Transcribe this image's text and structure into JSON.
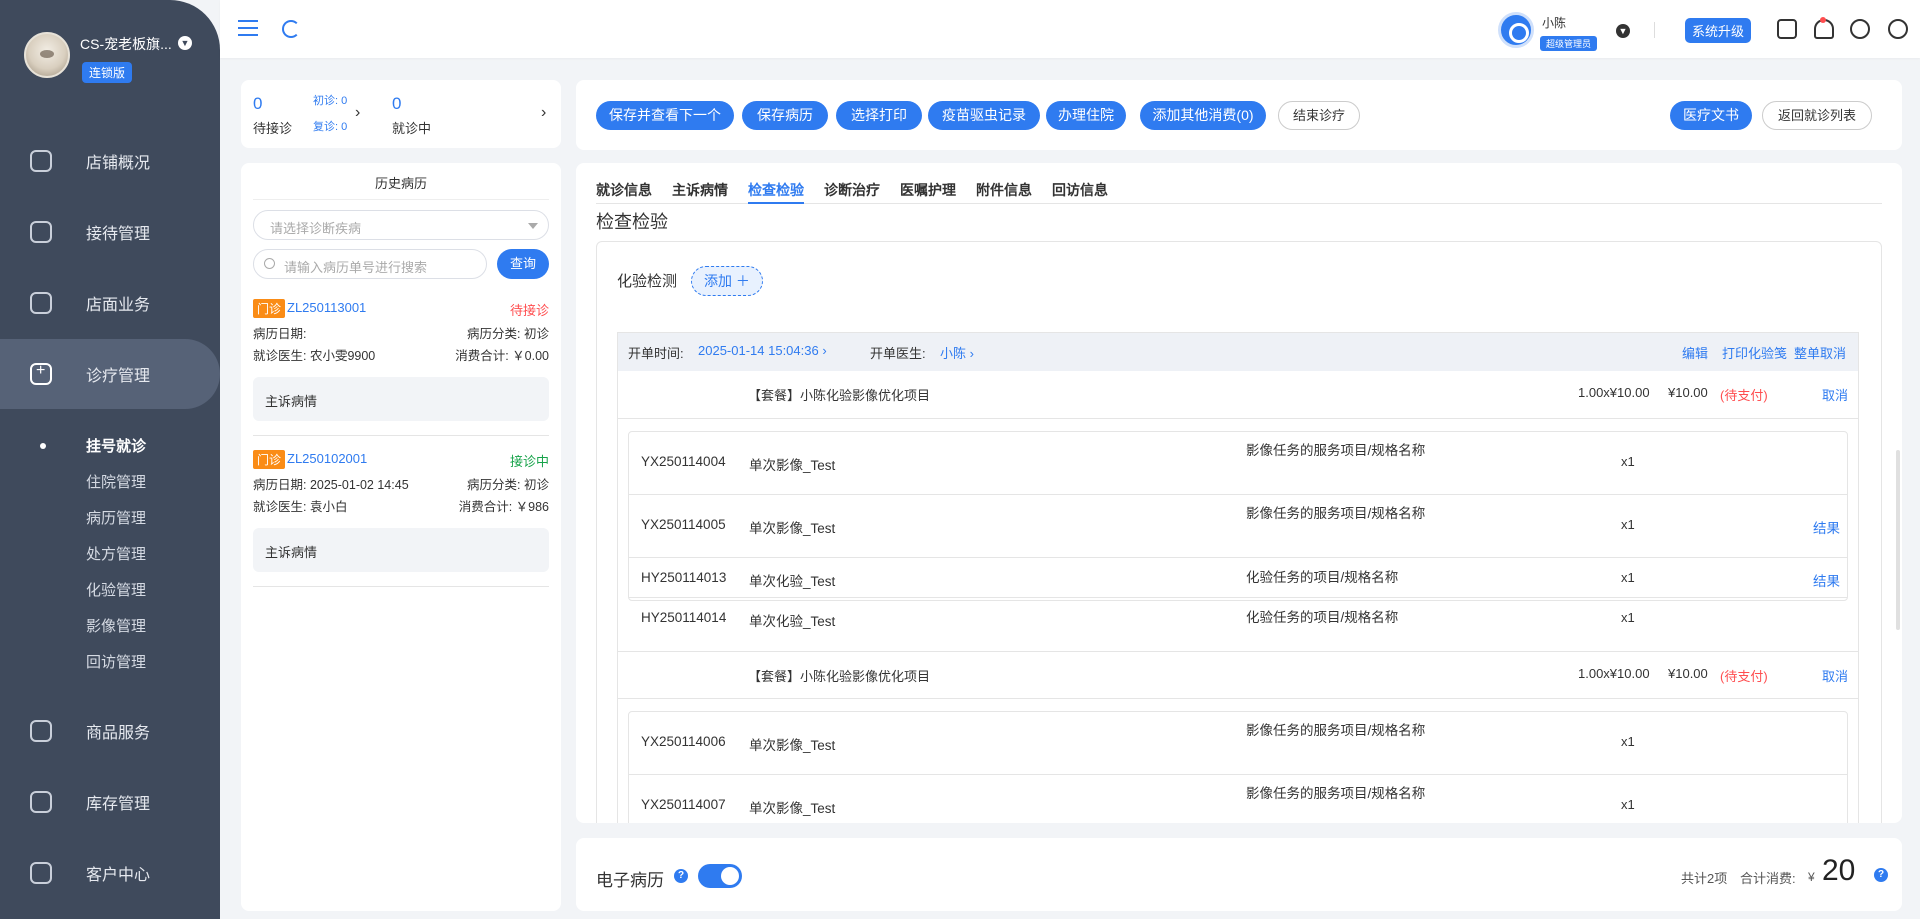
{
  "sidebar": {
    "store_name": "CS-宠老板旗...",
    "edition": "连锁版",
    "nav": [
      {
        "label": "店铺概况",
        "icon": "dashboard-icon"
      },
      {
        "label": "接待管理",
        "icon": "reception-icon"
      },
      {
        "label": "店面业务",
        "icon": "store-icon"
      },
      {
        "label": "诊疗管理",
        "icon": "medical-kit-icon"
      },
      {
        "label": "商品服务",
        "icon": "goods-icon"
      },
      {
        "label": "库存管理",
        "icon": "inventory-icon"
      },
      {
        "label": "客户中心",
        "icon": "customer-icon"
      }
    ],
    "sub_items": [
      "挂号就诊",
      "住院管理",
      "病历管理",
      "处方管理",
      "化验管理",
      "影像管理",
      "回访管理"
    ]
  },
  "topbar": {
    "user_name": "小陈",
    "user_role": "超级管理员",
    "upgrade_label": "系统升级"
  },
  "queue": {
    "waiting_count": "0",
    "waiting_label": "待接诊",
    "first_visit": "初诊: 0",
    "revisit": "复诊: 0",
    "in_progress_count": "0",
    "in_progress_label": "就诊中"
  },
  "history": {
    "title": "历史病历",
    "select_placeholder": "请选择诊断疾病",
    "search_placeholder": "请输入病历单号进行搜索",
    "search_button": "查询",
    "records": [
      {
        "tag": "门诊",
        "id": "ZL250113001",
        "status": "待接诊",
        "status_color": "#ff4d4f",
        "date": "病历日期:",
        "category": "病历分类: 初诊",
        "doctor": "就诊医生: 农小雯9900",
        "total": "消费合计: ￥0.00",
        "complaint": "主诉病情"
      },
      {
        "tag": "门诊",
        "id": "ZL250102001",
        "status": "接诊中",
        "status_color": "#17a34a",
        "date": "病历日期: 2025-01-02 14:45",
        "category": "病历分类: 初诊",
        "doctor": "就诊医生: 袁小白",
        "total": "消费合计: ￥986",
        "complaint": "主诉病情"
      }
    ]
  },
  "actions": {
    "save_next": "保存并查看下一个",
    "save_record": "保存病历",
    "select_print": "选择打印",
    "vaccine_record": "疫苗驱虫记录",
    "hospitalize": "办理住院",
    "add_other": "添加其他消费(0)",
    "end_visit": "结束诊疗",
    "medical_docs": "医疗文书",
    "back_to_list": "返回就诊列表"
  },
  "tabs": [
    "就诊信息",
    "主诉病情",
    "检查检验",
    "诊断治疗",
    "医嘱护理",
    "附件信息",
    "回访信息"
  ],
  "section_title": "检查检验",
  "lab": {
    "title": "化验检测",
    "add_label": "添加 ＋",
    "order_time_label": "开单时间:",
    "order_time": "2025-01-14 15:04:36",
    "order_doctor_label": "开单医生:",
    "order_doctor": "小陈",
    "edit": "编辑",
    "print_lab": "打印化验笺",
    "cancel_all": "整单取消",
    "packages": [
      {
        "name": "【套餐】小陈化验影像优化项目",
        "qty": "1.00x¥10.00",
        "price": "¥10.00",
        "status": "(待支付)",
        "cancel": "取消",
        "items": [
          {
            "code": "YX250114004",
            "name": "单次影像_Test",
            "desc": "影像任务的服务项目/规格名称",
            "count": "x1",
            "link": ""
          },
          {
            "code": "YX250114005",
            "name": "单次影像_Test",
            "desc": "影像任务的服务项目/规格名称",
            "count": "x1",
            "link": "结果"
          },
          {
            "code": "HY250114013",
            "name": "单次化验_Test",
            "desc": "化验任务的项目/规格名称",
            "count": "x1",
            "link": "结果"
          },
          {
            "code": "HY250114014",
            "name": "单次化验_Test",
            "desc": "化验任务的项目/规格名称",
            "count": "x1",
            "link": ""
          }
        ]
      },
      {
        "name": "【套餐】小陈化验影像优化项目",
        "qty": "1.00x¥10.00",
        "price": "¥10.00",
        "status": "(待支付)",
        "cancel": "取消",
        "items": [
          {
            "code": "YX250114006",
            "name": "单次影像_Test",
            "desc": "影像任务的服务项目/规格名称",
            "count": "x1",
            "link": ""
          },
          {
            "code": "YX250114007",
            "name": "单次影像_Test",
            "desc": "影像任务的服务项目/规格名称",
            "count": "x1",
            "link": ""
          }
        ]
      }
    ]
  },
  "footer": {
    "emr_label": "电子病历",
    "help": "?",
    "total_count": "共计2项",
    "total_label": "合计消费:",
    "currency": "¥",
    "total_value": "20"
  },
  "colors": {
    "sidebar_bg": "#3f4a5c",
    "accent": "#2f7bf0",
    "pending": "#ff4d4f",
    "in_progress": "#17a34a",
    "tag": "#fa8c16"
  }
}
